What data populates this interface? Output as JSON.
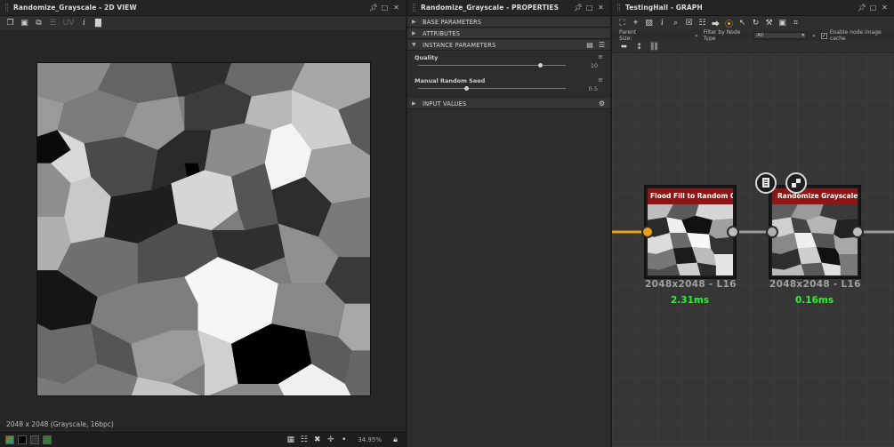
{
  "view2d": {
    "title": "Randomize_Grayscale - 2D VIEW",
    "image_info": "2048 x 2048 (Grayscale, 16bpc)",
    "zoom": "34.95%"
  },
  "properties": {
    "title": "Randomize_Grayscale - PROPERTIES",
    "sections": {
      "base": "BASE PARAMETERS",
      "attributes": "ATTRIBUTES",
      "instance": "INSTANCE PARAMETERS",
      "input": "INPUT VALUES"
    },
    "params": [
      {
        "label": "Quality",
        "value": "10",
        "fraction": 0.83
      },
      {
        "label": "Manual Random Seed",
        "value": "0.5",
        "fraction": 0.33
      }
    ]
  },
  "graph": {
    "title": "TestingHall - GRAPH",
    "parent_size_label": "Parent Size:",
    "filter_label": "Filter by Node Type",
    "filter_value": "All",
    "cache_label": "Enable node image cache",
    "cache_checked": true,
    "nodes": [
      {
        "title": "Flood Fill to Random Gr...",
        "resolution": "2048x2048 - L16",
        "time": "2.31ms"
      },
      {
        "title": "Randomize Grayscale",
        "resolution": "2048x2048 - L16",
        "time": "0.16ms"
      }
    ],
    "colors": {
      "node_header": "#8c1515",
      "time_text": "#2ef22e",
      "wire_active": "#e8a020"
    }
  }
}
